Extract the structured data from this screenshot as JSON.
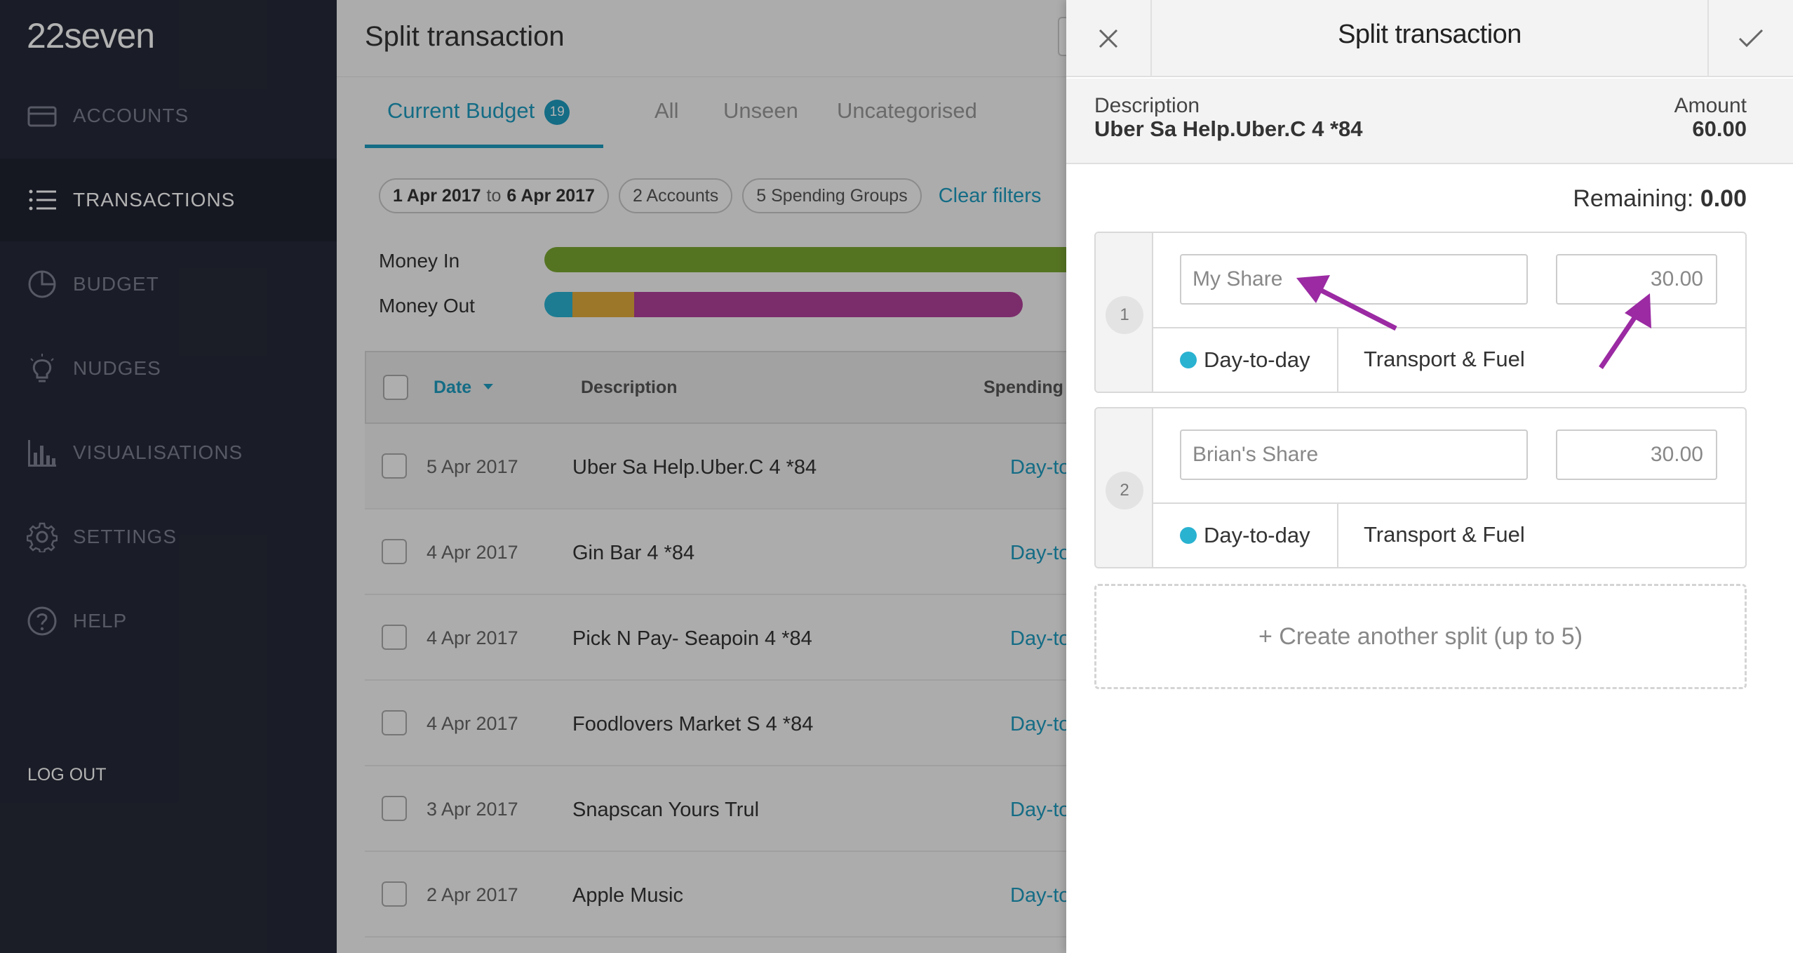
{
  "app": {
    "logo": "22seven"
  },
  "sidebar": {
    "items": [
      {
        "label": "ACCOUNTS",
        "icon": "credit-card-icon",
        "active": false
      },
      {
        "label": "TRANSACTIONS",
        "icon": "list-icon",
        "active": true
      },
      {
        "label": "BUDGET",
        "icon": "pie-chart-icon",
        "active": false
      },
      {
        "label": "NUDGES",
        "icon": "lightbulb-icon",
        "active": false
      },
      {
        "label": "VISUALISATIONS",
        "icon": "bar-chart-icon",
        "active": false
      },
      {
        "label": "SETTINGS",
        "icon": "gear-icon",
        "active": false
      },
      {
        "label": "HELP",
        "icon": "help-icon",
        "active": false
      }
    ],
    "logout": "LOG OUT"
  },
  "main": {
    "title": "Split transaction",
    "tabs": [
      {
        "label": "Current Budget",
        "badge": "19",
        "active": true
      },
      {
        "label": "All"
      },
      {
        "label": "Unseen"
      },
      {
        "label": "Uncategorised"
      }
    ],
    "filters": {
      "date_from": "1 Apr 2017",
      "date_to_word": "to",
      "date_to": "6 Apr 2017",
      "accounts": "2 Accounts",
      "spending_groups": "5 Spending Groups",
      "clear": "Clear filters"
    },
    "money": {
      "in_label": "Money In",
      "out_label": "Money Out",
      "in_color": "#7aa632",
      "out_colors": [
        "#2ab2d1",
        "#e0a93b",
        "#b0409a"
      ]
    },
    "table": {
      "headers": {
        "date": "Date",
        "description": "Description",
        "spending": "Spending"
      },
      "rows": [
        {
          "date": "5 Apr 2017",
          "description": "Uber Sa Help.Uber.C 4 *84",
          "group": "Day-to-day"
        },
        {
          "date": "4 Apr 2017",
          "description": "Gin Bar 4 *84",
          "group": "Day-to-day"
        },
        {
          "date": "4 Apr 2017",
          "description": "Pick N Pay- Seapoin 4 *84",
          "group": "Day-to-day"
        },
        {
          "date": "4 Apr 2017",
          "description": "Foodlovers Market S 4 *84",
          "group": "Day-to-day"
        },
        {
          "date": "3 Apr 2017",
          "description": "Snapscan Yours Trul",
          "group": "Day-to-day"
        },
        {
          "date": "2 Apr 2017",
          "description": "Apple Music",
          "group": "Day-to-day"
        }
      ]
    }
  },
  "panel": {
    "title": "Split transaction",
    "description_label": "Description",
    "description_value": "Uber Sa Help.Uber.C 4 *84",
    "amount_label": "Amount",
    "amount_value": "60.00",
    "remaining_label": "Remaining:",
    "remaining_value": "0.00",
    "splits": [
      {
        "number": "1",
        "name_placeholder": "My Share",
        "amount": "30.00",
        "group": "Day-to-day",
        "category": "Transport & Fuel"
      },
      {
        "number": "2",
        "name_placeholder": "Brian's Share",
        "amount": "30.00",
        "group": "Day-to-day",
        "category": "Transport & Fuel"
      }
    ],
    "create_split": "+ Create another split (up to 5)",
    "annotation_color": "#9b2aa3"
  }
}
